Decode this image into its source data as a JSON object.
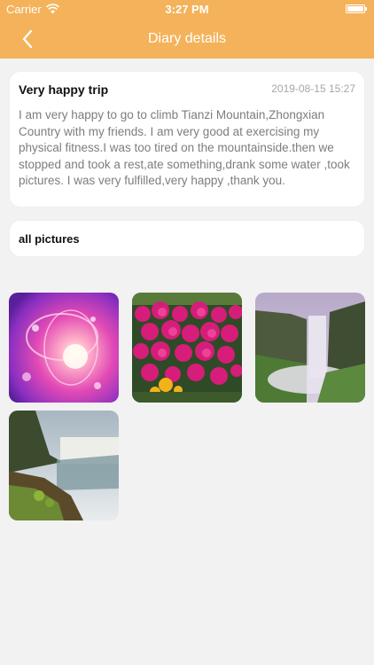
{
  "status_bar": {
    "carrier": "Carrier",
    "time": "3:27 PM"
  },
  "nav": {
    "title": "Diary details",
    "back_icon": "chevron-left-icon"
  },
  "diary": {
    "title": "Very happy trip",
    "date": "2019-08-15 15:27",
    "body": "I am very happy to go to climb Tianzi Mountain,Zhongxian Country with my friends. I am very good at exercising my physical fitness.I was too tired on the mountainside.then we stopped and took a rest,ate something,drank some water ,took pictures. I was very fulfilled,very happy ,thank you."
  },
  "pictures": {
    "label": "all pictures",
    "items": [
      {
        "subject": "pink-light-abstract"
      },
      {
        "subject": "magenta-flowers"
      },
      {
        "subject": "misty-waterfall"
      },
      {
        "subject": "waterfall-cliff"
      }
    ]
  },
  "colors": {
    "accent": "#f4b25a",
    "background": "#f2f2f2",
    "card": "#ffffff",
    "title_text": "#111111",
    "body_text": "#7d7d7d",
    "date_text": "#a7a7a7"
  }
}
